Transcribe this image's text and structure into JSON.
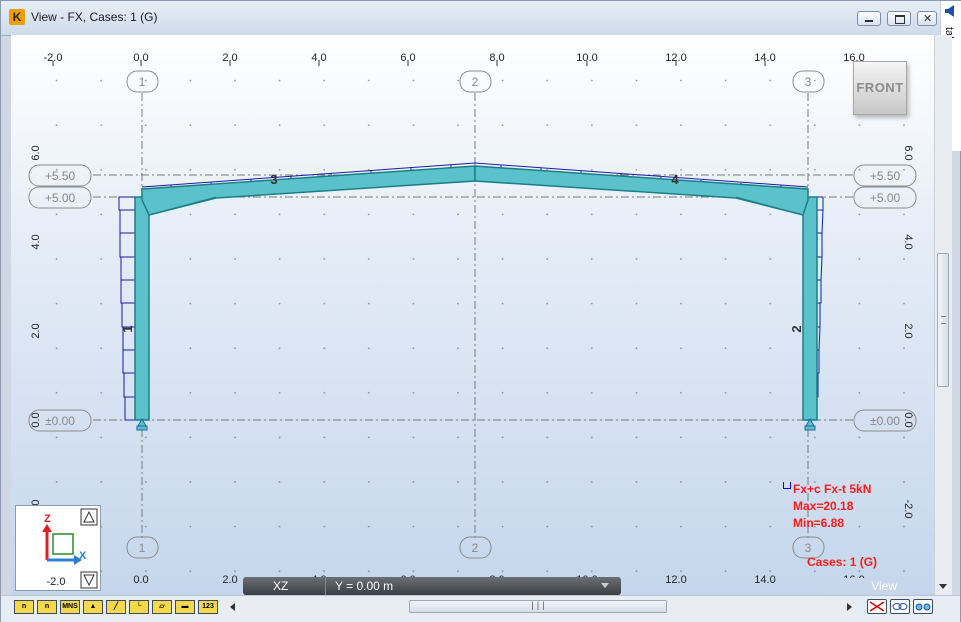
{
  "window": {
    "title": "View - FX, Cases: 1 (G)",
    "app_icon_letter": "K",
    "buttons": [
      "minimize",
      "restore",
      "close"
    ]
  },
  "side_panel": {
    "label": "tabs",
    "icon": "arrow-left-icon"
  },
  "rulers": {
    "top": [
      "-2.0",
      "0.0",
      "2.0",
      "4.0",
      "6.0",
      "8.0",
      "10.0",
      "12.0",
      "14.0",
      "16.0"
    ],
    "bottom": [
      "-2.0",
      "0.0",
      "2.0",
      "4.0",
      "6.0",
      "8.0",
      "10.0",
      "12.0",
      "14.0",
      "16.0"
    ],
    "left": [
      "6.0",
      "4.0",
      "2.0",
      "0.0",
      "-2.0"
    ],
    "right": [
      "6.0",
      "4.0",
      "2.0",
      "0.0",
      "-2.0"
    ]
  },
  "gridlines": {
    "axes_top": [
      "1",
      "2",
      "3"
    ],
    "axes_bottom": [
      "1",
      "2",
      "3"
    ],
    "levels_left": [
      "+5.50",
      "+5.00",
      "±0.00"
    ],
    "levels_right": [
      "+5.50",
      "+5.00",
      "±0.00"
    ]
  },
  "members": [
    "1",
    "2",
    "3",
    "4"
  ],
  "view_cube": {
    "label": "FRONT"
  },
  "legend": {
    "line1": "Fx+c Fx-t  5kN",
    "max": "Max=20.18",
    "min": "Min=6.88",
    "cases": "Cases: 1 (G)",
    "color": "#ff1a1a"
  },
  "coord_bar": {
    "plane": "XZ",
    "y": "Y = 0.00 m"
  },
  "view_button": {
    "label": "View"
  },
  "axis_widget": {
    "z": "Z",
    "x": "X"
  },
  "bottom_toolbar": [
    "n",
    "n",
    "MNS",
    "shape",
    "member",
    "axes",
    "plane",
    "bar",
    "123"
  ],
  "colors": {
    "member_fill": "#5bc2cb",
    "member_edge": "#1a7f86",
    "diagram": "#1a1aa8",
    "grid": "#7a7a7a"
  }
}
